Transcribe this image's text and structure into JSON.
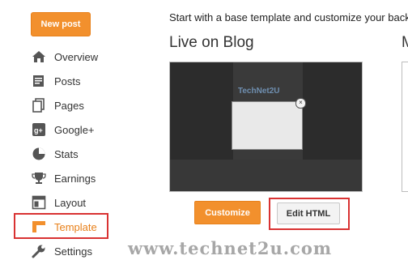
{
  "sidebar": {
    "new_post": "New post",
    "items": [
      {
        "label": "Overview",
        "icon": "home-icon"
      },
      {
        "label": "Posts",
        "icon": "posts-icon"
      },
      {
        "label": "Pages",
        "icon": "pages-icon"
      },
      {
        "label": "Google+",
        "icon": "google-plus-icon"
      },
      {
        "label": "Stats",
        "icon": "stats-icon"
      },
      {
        "label": "Earnings",
        "icon": "trophy-icon"
      },
      {
        "label": "Layout",
        "icon": "layout-icon"
      },
      {
        "label": "Template",
        "icon": "template-icon",
        "active": true
      },
      {
        "label": "Settings",
        "icon": "wrench-icon"
      }
    ]
  },
  "main": {
    "intro": "Start with a base template and customize your backgr",
    "live_title": "Live on Blog",
    "next_title": "M",
    "preview": {
      "logo_text": "TechNet2U"
    },
    "customize": "Customize",
    "edit_html": "Edit HTML"
  },
  "watermark": "www.technet2u.com",
  "colors": {
    "accent": "#f2902d",
    "highlight": "#d93232",
    "active_text": "#e8801a"
  }
}
